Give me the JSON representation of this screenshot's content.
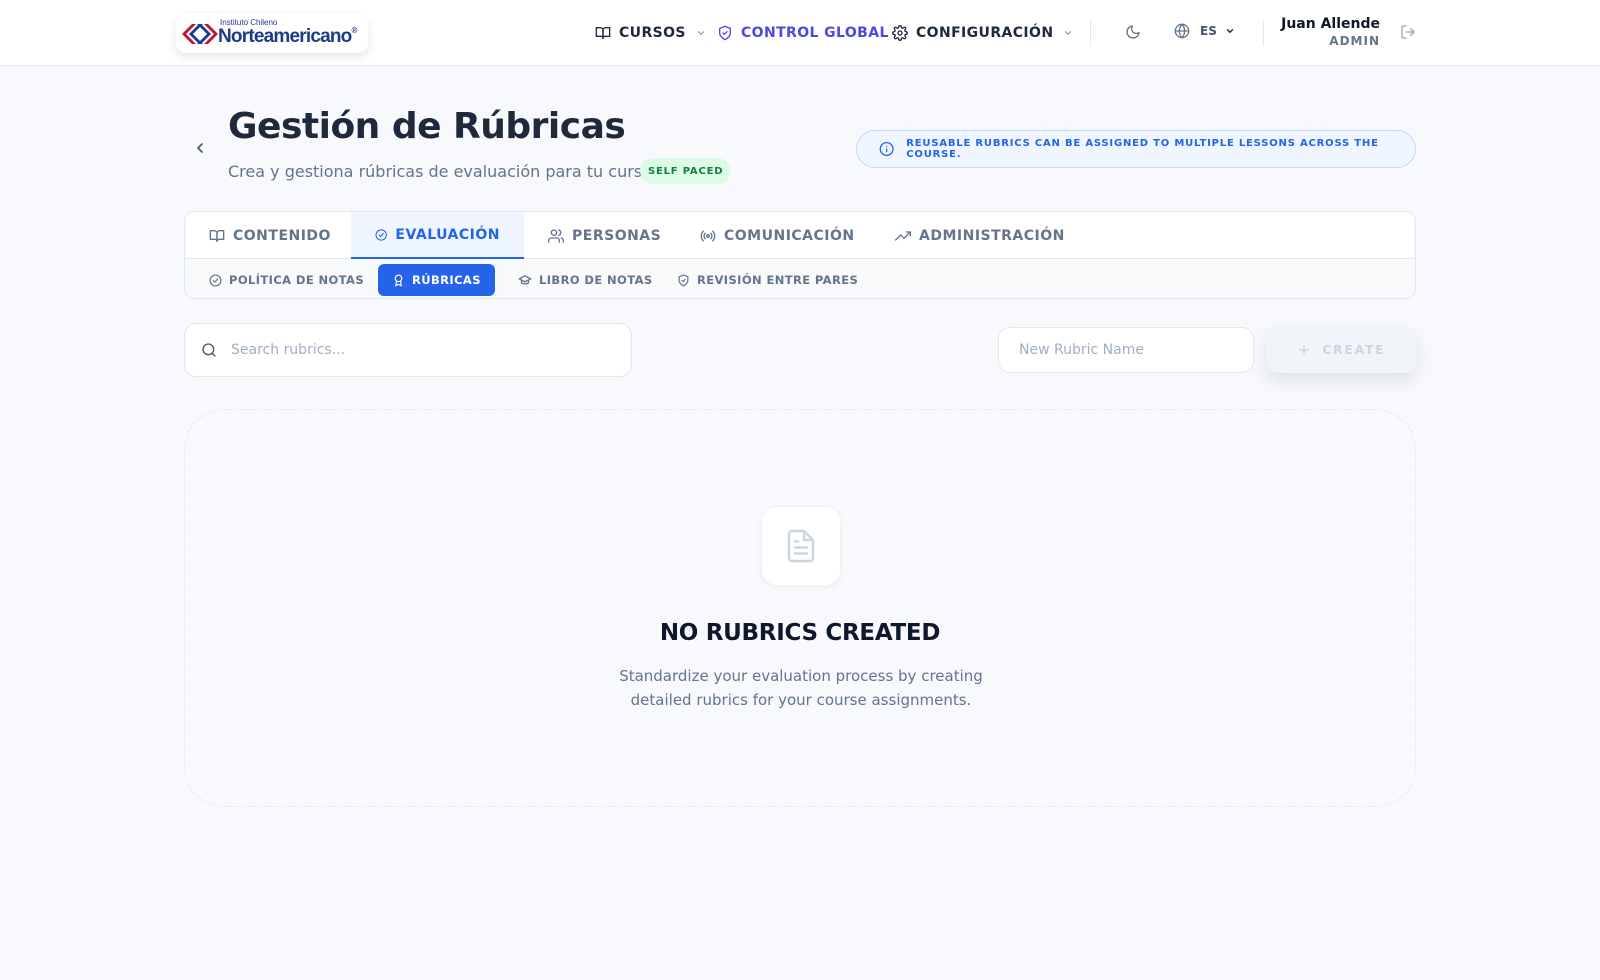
{
  "header": {
    "logo_small": "Instituto Chileno",
    "logo_big": "Norteamericano",
    "logo_reg": "®",
    "nav": {
      "cursos": "CURSOS",
      "control_global": "CONTROL GLOBAL",
      "configuracion": "CONFIGURACIÓN"
    },
    "language": "ES",
    "user_name": "Juan Allende",
    "user_role": "ADMIN"
  },
  "page": {
    "title": "Gestión de Rúbricas",
    "subtitle": "Crea y gestiona rúbricas de evaluación para tu curso.",
    "badge": "SELF PACED",
    "info_banner": "REUSABLE RUBRICS CAN BE ASSIGNED TO MULTIPLE LESSONS ACROSS THE COURSE."
  },
  "tabs": [
    {
      "label": "CONTENIDO",
      "icon": "book-icon"
    },
    {
      "label": "EVALUACIÓN",
      "icon": "check-circle-icon",
      "active": true
    },
    {
      "label": "PERSONAS",
      "icon": "users-icon"
    },
    {
      "label": "COMUNICACIÓN",
      "icon": "broadcast-icon"
    },
    {
      "label": "ADMINISTRACIÓN",
      "icon": "trending-up-icon"
    }
  ],
  "subtabs": [
    {
      "label": "POLÍTICA DE NOTAS",
      "icon": "check-circle-icon"
    },
    {
      "label": "RÚBRICAS",
      "icon": "award-icon",
      "active": true
    },
    {
      "label": "LIBRO DE NOTAS",
      "icon": "graduation-cap-icon"
    },
    {
      "label": "REVISIÓN ENTRE PARES",
      "icon": "shield-check-icon"
    }
  ],
  "search": {
    "placeholder": "Search rubrics...",
    "value": ""
  },
  "create": {
    "placeholder": "New Rubric Name",
    "value": "",
    "button_label": "CREATE"
  },
  "empty_state": {
    "icon": "file-text-icon",
    "title": "NO RUBRICS CREATED",
    "description": "Standardize your evaluation process by creating detailed rubrics for your course assignments."
  },
  "colors": {
    "accent": "#2563eb",
    "control_global": "#4f46e5",
    "badge_bg": "#dcfce7",
    "badge_text": "#15803d"
  }
}
